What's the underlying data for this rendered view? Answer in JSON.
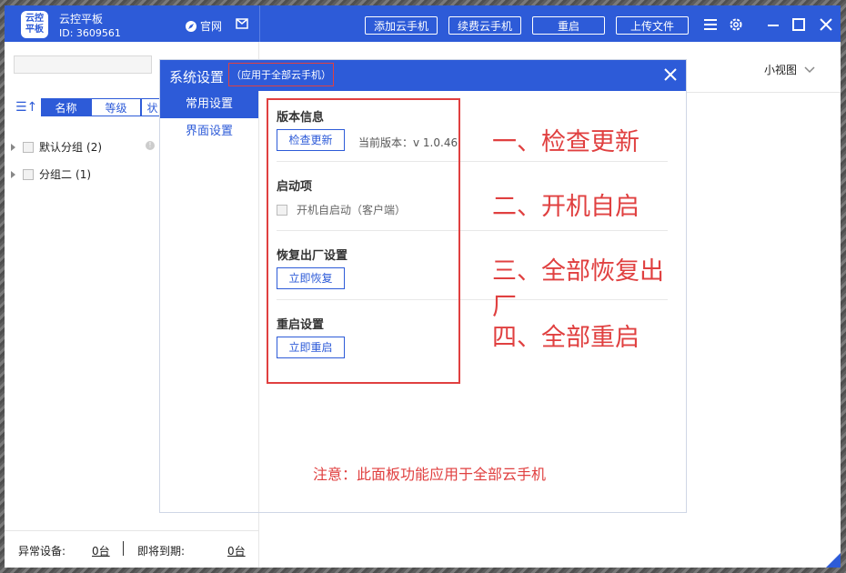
{
  "app": {
    "logo_text": "云控\n平板",
    "name": "云控平板",
    "id_label": "ID: 3609561",
    "official_label": "官网"
  },
  "toolbar": {
    "add_phone": "添加云手机",
    "renew_phone": "续费云手机",
    "restart": "重启",
    "upload": "上传文件"
  },
  "sidebar": {
    "sort_tabs": [
      "名称",
      "等级",
      "状"
    ],
    "groups": [
      {
        "label": "默认分组",
        "count": "(2)"
      },
      {
        "label": "分组二",
        "count": "(1)"
      }
    ],
    "footer": {
      "abnormal_label": "异常设备:",
      "abnormal_value": "0台",
      "expiring_label": "即将到期:",
      "expiring_value": "0台"
    }
  },
  "main": {
    "view_mode": "小视图"
  },
  "dialog": {
    "title": "系统设置",
    "subtitle": "（应用于全部云手机）",
    "nav": [
      "常用设置",
      "界面设置"
    ],
    "sections": {
      "version": {
        "title": "版本信息",
        "button": "检查更新",
        "current": "当前版本：v 1.0.46"
      },
      "startup": {
        "title": "启动项",
        "checkbox": "开机自启动（客户端）"
      },
      "reset": {
        "title": "恢复出厂设置",
        "button": "立即恢复"
      },
      "reboot": {
        "title": "重启设置",
        "button": "立即重启"
      }
    },
    "annotations": [
      "一、检查更新",
      "二、开机自启",
      "三、全部恢复出厂",
      "四、全部重启"
    ],
    "note": "注意：此面板功能应用于全部云手机"
  },
  "colors": {
    "accent": "#2d5bd8",
    "annotation": "#e04040"
  }
}
